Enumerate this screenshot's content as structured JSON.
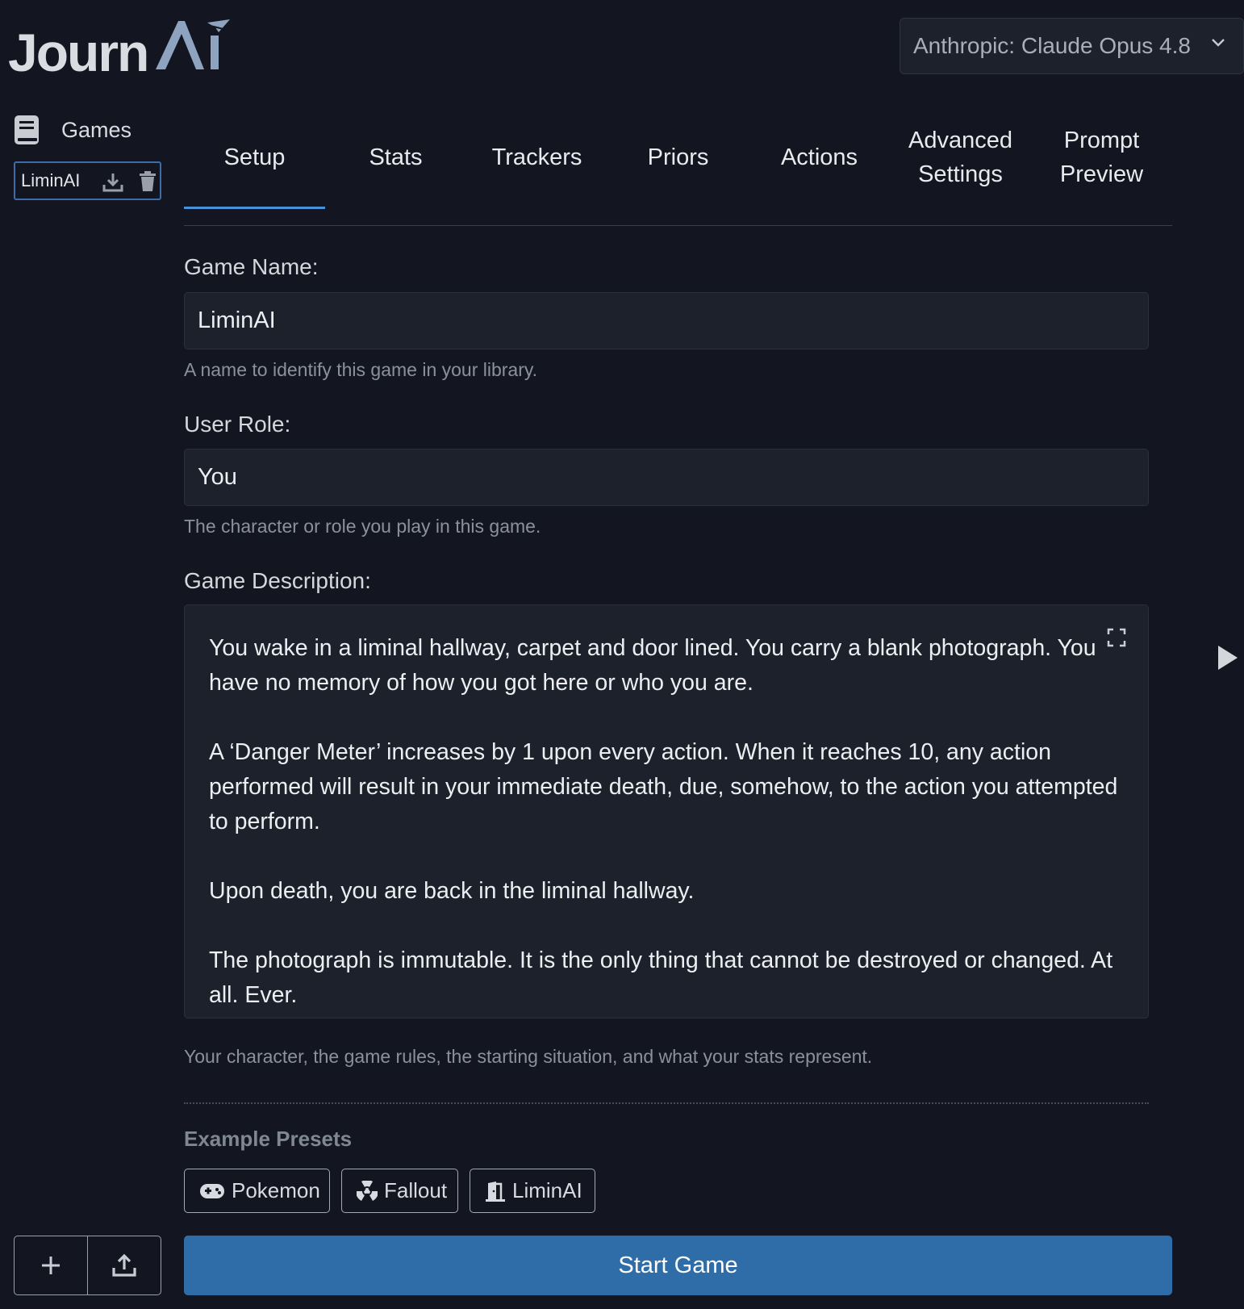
{
  "header": {
    "logo_text": "Journ",
    "logo_ai_text": "Ai",
    "model_select_value": "Anthropic: Claude Opus 4.8"
  },
  "sidebar": {
    "title": "Games",
    "games": [
      {
        "name": "LiminAI"
      }
    ]
  },
  "tabs": [
    {
      "label": "Setup",
      "active": true
    },
    {
      "label": "Stats"
    },
    {
      "label": "Trackers"
    },
    {
      "label": "Priors"
    },
    {
      "label": "Actions"
    },
    {
      "label": "Advanced\nSettings"
    },
    {
      "label": "Prompt\nPreview"
    }
  ],
  "form": {
    "game_name": {
      "label": "Game Name:",
      "value": "LiminAI",
      "hint": "A name to identify this game in your library."
    },
    "user_role": {
      "label": "User Role:",
      "value": "You",
      "hint": "The character or role you play in this game."
    },
    "game_description": {
      "label": "Game Description:",
      "value": "You wake in a liminal hallway, carpet and door lined. You carry a blank photograph. You have no memory of how you got here or who you are.\n\nA ‘Danger Meter’ increases by 1 upon every action. When it reaches 10, any action performed will result in your immediate death, due, somehow, to the action you attempted to perform.\n\nUpon death, you are back in the liminal hallway.\n\nThe photograph is immutable. It is the only thing that cannot be destroyed or changed. At all. Ever.",
      "hint": "Your character, the game rules, the starting situation, and what your stats represent."
    }
  },
  "presets": {
    "title": "Example Presets",
    "items": [
      {
        "label": "Pokemon",
        "icon": "gamepad-icon"
      },
      {
        "label": "Fallout",
        "icon": "radiation-icon"
      },
      {
        "label": "LiminAI",
        "icon": "door-icon"
      }
    ]
  },
  "actions": {
    "start_label": "Start Game"
  },
  "colors": {
    "background": "#131620",
    "accent": "#2f6da8",
    "tab_underline": "#4a90d9"
  }
}
